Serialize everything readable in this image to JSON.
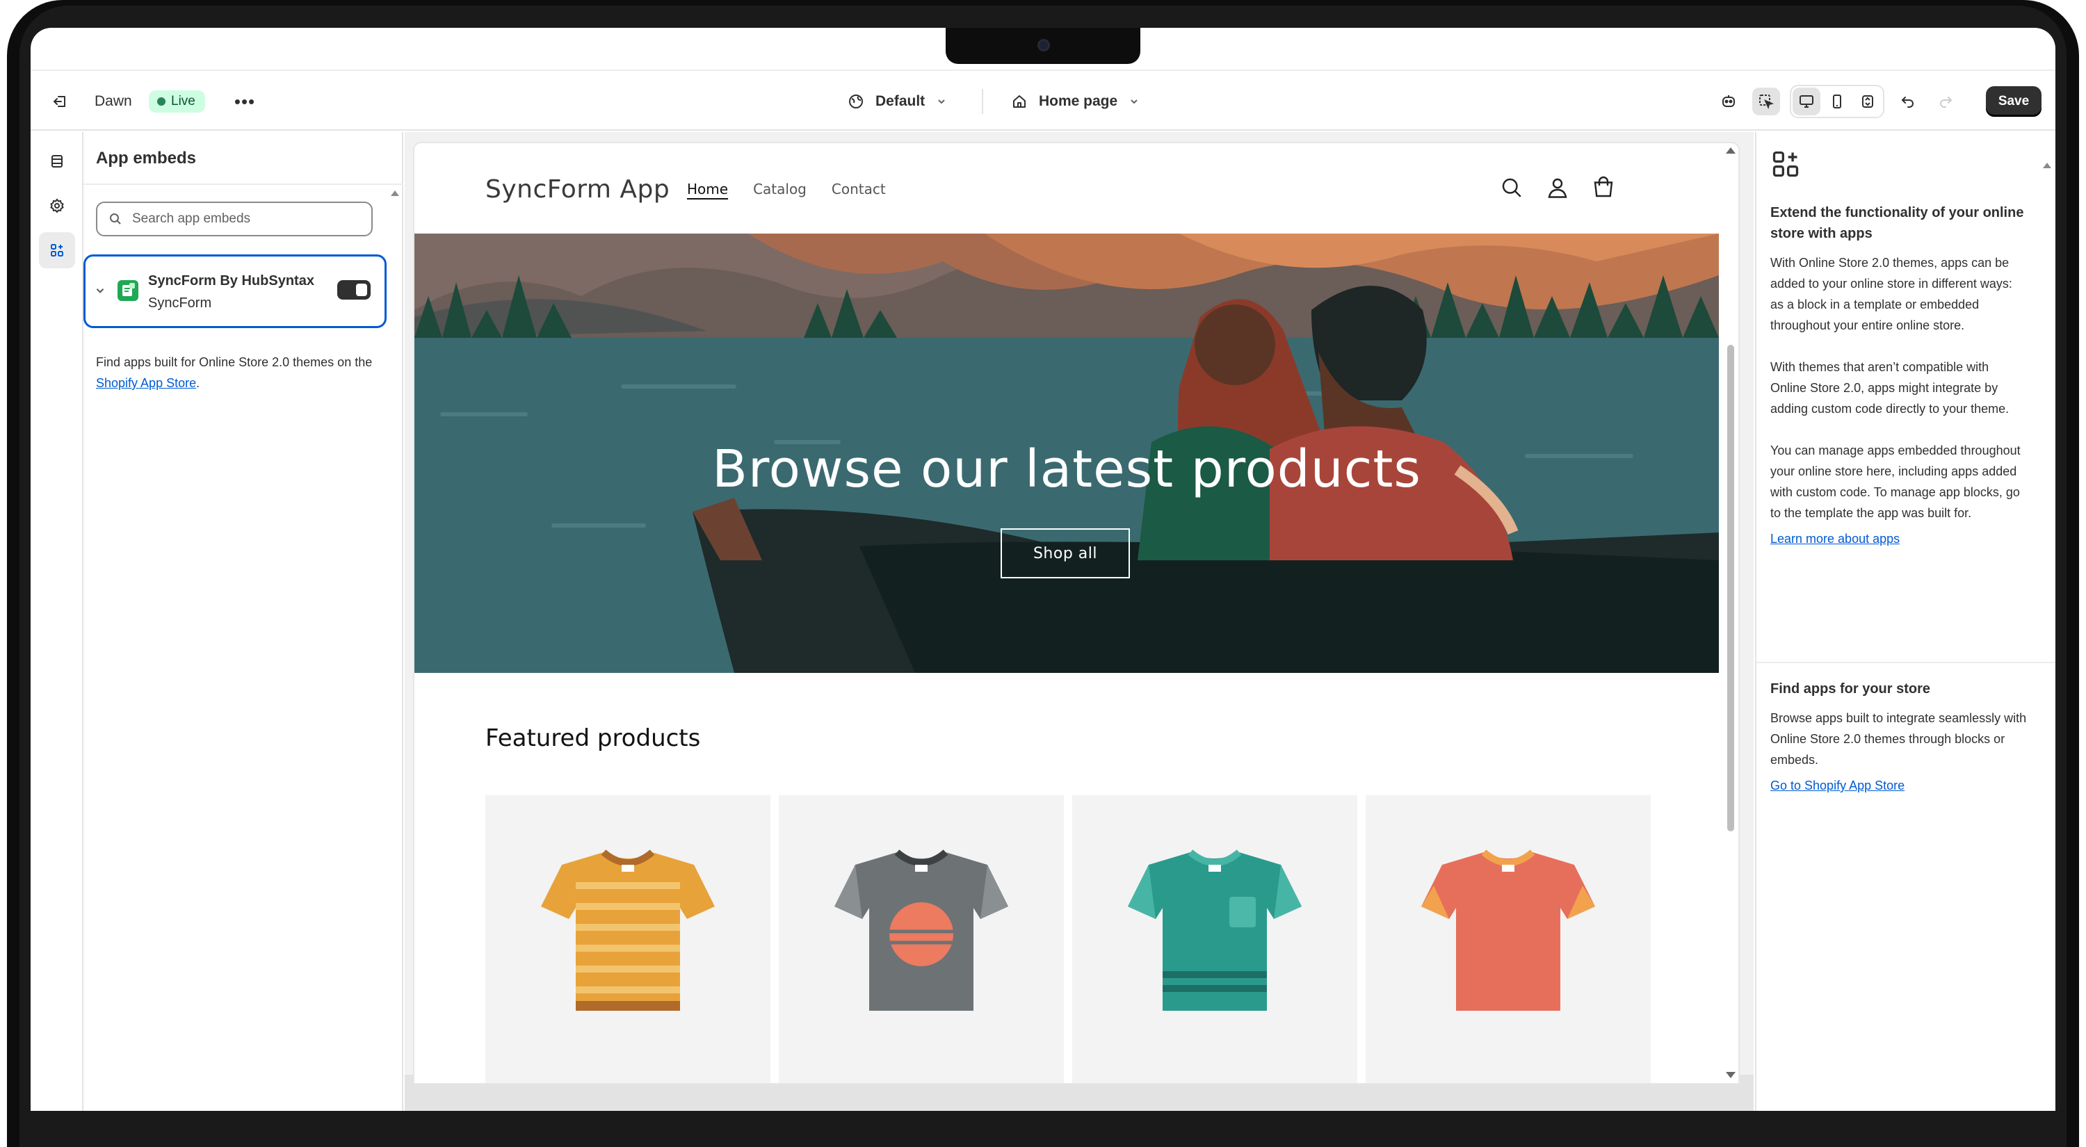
{
  "topbar": {
    "theme_name": "Dawn",
    "status_badge": "Live",
    "more_label": "•••",
    "template_select": "Default",
    "page_select": "Home page",
    "save_label": "Save"
  },
  "left_panel": {
    "title": "App embeds",
    "search_placeholder": "Search app embeds",
    "embed": {
      "name": "SyncForm By HubSyntax",
      "subtitle": "SyncForm",
      "enabled": true
    },
    "help_text": "Find apps built for Online Store 2.0 themes on the ",
    "help_link": "Shopify App Store",
    "help_end": "."
  },
  "preview": {
    "store_name": "SyncForm App",
    "nav": [
      "Home",
      "Catalog",
      "Contact"
    ],
    "hero_title": "Browse our latest products",
    "hero_button": "Shop all",
    "featured_title": "Featured products",
    "products": [
      {
        "icon": "orange-striped-tshirt-icon",
        "color": "#e8a23a"
      },
      {
        "icon": "grey-sunset-tshirt-icon",
        "color": "#6d7275"
      },
      {
        "icon": "teal-pocket-tshirt-icon",
        "color": "#2a9a8c"
      },
      {
        "icon": "coral-tshirt-icon",
        "color": "#e66f5c"
      }
    ]
  },
  "right_panel": {
    "heading": "Extend the functionality of your online store with apps",
    "paragraphs": [
      "With Online Store 2.0 themes, apps can be added to your online store in different ways: as a block in a template or embedded throughout your entire online store.",
      "With themes that aren’t compatible with Online Store 2.0, apps might integrate by adding custom code directly to your theme.",
      "You can manage apps embedded throughout your online store here, including apps added with custom code. To manage app blocks, go to the template the app was built for."
    ],
    "learn_more": "Learn more about apps",
    "section2_heading": "Find apps for your store",
    "section2_text": "Browse apps built to integrate seamlessly with Online Store 2.0 themes through blocks or embeds.",
    "section2_link": "Go to Shopify App Store"
  },
  "colors": {
    "accent": "#005bd3",
    "live_bg": "#cdfee1",
    "live_dot": "#29845a",
    "save_bg": "#303030"
  }
}
